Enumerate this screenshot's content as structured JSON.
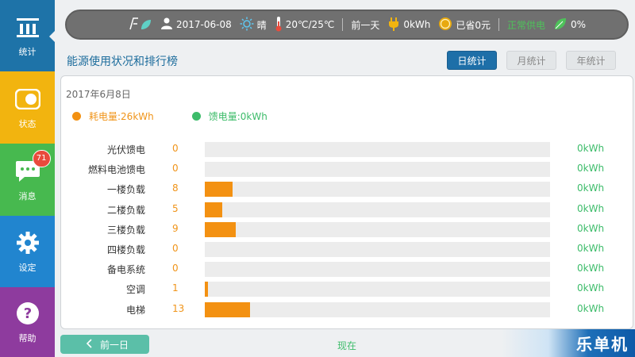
{
  "sidebar": {
    "items": [
      {
        "label": "统计",
        "icon": "bar-chart-icon"
      },
      {
        "label": "状态",
        "icon": "toggle-icon"
      },
      {
        "label": "消息",
        "icon": "chat-icon",
        "badge": "71"
      },
      {
        "label": "设定",
        "icon": "gear-icon"
      },
      {
        "label": "帮助",
        "icon": "question-icon"
      }
    ]
  },
  "topbar": {
    "date": "2017-06-08",
    "weather": "晴",
    "temperature": "20℃/25℃",
    "prev_day": "前一天",
    "power": "0kWh",
    "saved": "已省0元",
    "status": "正常供电",
    "percent": "0%"
  },
  "header": {
    "title": "能源使用状况和排行榜",
    "tabs": [
      "日统计",
      "月统计",
      "年统计"
    ]
  },
  "card": {
    "date": "2017年6月8日",
    "legend": {
      "consumption": "耗电量:26kWh",
      "feed": "馈电量:0kWh"
    }
  },
  "colors": {
    "consumption": "#f39112",
    "feed": "#3dbc6a"
  },
  "chart_data": {
    "type": "bar",
    "orientation": "horizontal",
    "categories": [
      "光伏馈电",
      "燃料电池馈电",
      "一楼负载",
      "二楼负载",
      "三楼负载",
      "四楼负载",
      "备电系统",
      "空调",
      "电梯"
    ],
    "values": [
      0,
      0,
      8,
      5,
      9,
      0,
      0,
      1,
      13
    ],
    "feed_labels": [
      "0kWh",
      "0kWh",
      "0kWh",
      "0kWh",
      "0kWh",
      "0kWh",
      "0kWh",
      "0kWh",
      "0kWh"
    ],
    "xlim": [
      0,
      100
    ]
  },
  "bottom": {
    "prev_label": "前一日",
    "now_label": "现在",
    "brand": "乐单机"
  }
}
